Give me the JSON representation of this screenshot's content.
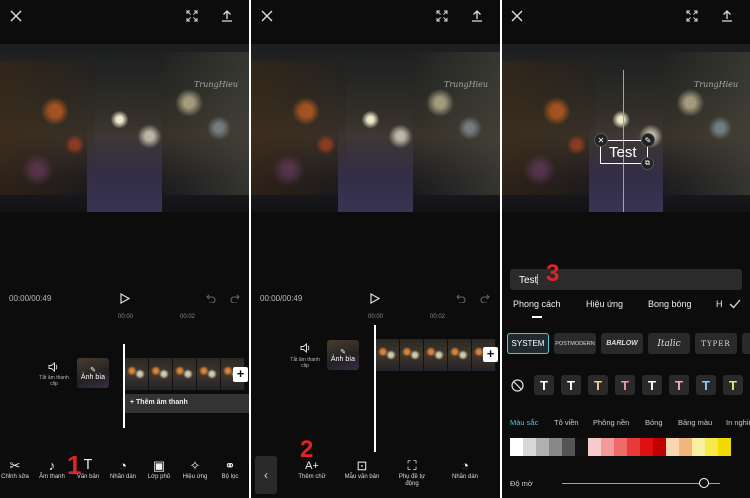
{
  "panel1": {
    "watermark": "TrungHieu",
    "timecode": "00:00/00:49",
    "ruler": [
      "00:00",
      "00:02"
    ],
    "mute_label": "Tắt âm thanh clip",
    "cover_label": "Ảnh bìa",
    "add_audio": "+ Thêm âm thanh",
    "toolbar": [
      "Chỉnh sửa",
      "Âm thanh",
      "Văn bản",
      "Nhãn dán",
      "Lớp phủ",
      "Hiệu ứng",
      "Bộ lọc"
    ],
    "step": "1"
  },
  "panel2": {
    "watermark": "TrungHieu",
    "timecode": "00:00/00:49",
    "ruler": [
      "00:00",
      "00:02"
    ],
    "mute_label": "Tắt âm thanh clip",
    "cover_label": "Ảnh bìa",
    "toolbar": [
      "Thêm chữ",
      "Mẫu văn bản",
      "Phụ đề tự động",
      "Nhãn dán"
    ],
    "step": "2"
  },
  "panel3": {
    "watermark": "TrungHieu",
    "overlay_text": "Test",
    "input_value": "Test",
    "step": "3",
    "tabs": [
      "Phong cách",
      "Hiệu ứng",
      "Bong bóng",
      "H"
    ],
    "fonts": [
      "SYSTEM",
      "POSTMODERN",
      "BARLOW",
      "Italic",
      "TYPER"
    ],
    "color_tabs": [
      "Màu sắc",
      "Tô viền",
      "Phông nền",
      "Bóng",
      "Bảng màu",
      "In nghiêng"
    ],
    "opacity_label": "Độ mờ",
    "opacity_value": 0.9,
    "text_swatch_colors": [
      "#ffffff",
      "#ffffff",
      "#f3d27a",
      "#f59a9a",
      "#ffffff",
      "#f7a8d8",
      "#7fd1f7",
      "#f2e56b"
    ],
    "palette": [
      "#ffffff",
      "#d8d8d8",
      "#b0b0b0",
      "#888888",
      "#555555",
      "#111111",
      "#f8c9c9",
      "#f39a9a",
      "#ee6b6b",
      "#e83a3a",
      "#e01010",
      "#c00000",
      "#f6d7b0",
      "#f2b67c",
      "#f8f0a0",
      "#f6e94a",
      "#f1da00"
    ]
  },
  "colors": {
    "accent_blue": "#4fc3d9",
    "step_red": "#e02424"
  }
}
